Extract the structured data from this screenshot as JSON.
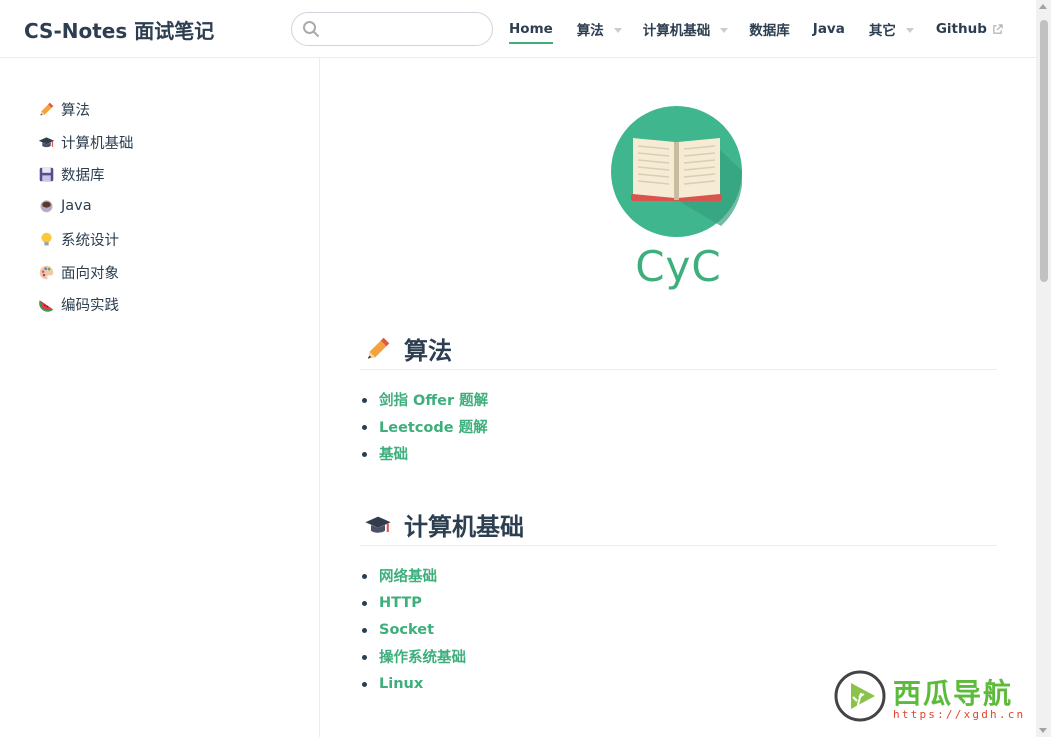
{
  "navbar": {
    "site_name": "CS-Notes 面试笔记",
    "search_placeholder": "",
    "links": [
      {
        "label": "Home",
        "active": true,
        "dropdown": false
      },
      {
        "label": "算法",
        "dropdown": true
      },
      {
        "label": "计算机基础",
        "dropdown": true
      },
      {
        "label": "数据库",
        "dropdown": false
      },
      {
        "label": "Java",
        "dropdown": false
      },
      {
        "label": "其它",
        "dropdown": true
      },
      {
        "label": "Github",
        "dropdown": false,
        "external": true
      }
    ]
  },
  "sidebar": {
    "items": [
      {
        "icon": "pencil-icon",
        "label": "算法"
      },
      {
        "icon": "graduation-cap-icon",
        "label": "计算机基础"
      },
      {
        "icon": "floppy-disk-icon",
        "label": "数据库"
      },
      {
        "icon": "coffee-icon",
        "label": "Java"
      },
      {
        "icon": "lightbulb-icon",
        "label": "系统设计"
      },
      {
        "icon": "palette-icon",
        "label": "面向对象"
      },
      {
        "icon": "watermelon-icon",
        "label": "编码实践"
      }
    ]
  },
  "hero": {
    "logo_icon": "open-book-icon",
    "text": "CyC"
  },
  "sections": {
    "algo": {
      "icon": "pencil-icon",
      "title": "算法",
      "links": [
        "剑指 Offer 题解",
        "Leetcode 题解",
        "基础"
      ]
    },
    "cs": {
      "icon": "graduation-cap-icon",
      "title": "计算机基础",
      "links": [
        "网络基础",
        "HTTP",
        "Socket",
        "操作系统基础",
        "Linux"
      ]
    }
  },
  "watermark": {
    "title": "西瓜导航",
    "url": "https://xgdh.cn"
  },
  "colors": {
    "accent": "#3eaf7c",
    "text": "#2c3e50",
    "border": "#eaecef"
  }
}
